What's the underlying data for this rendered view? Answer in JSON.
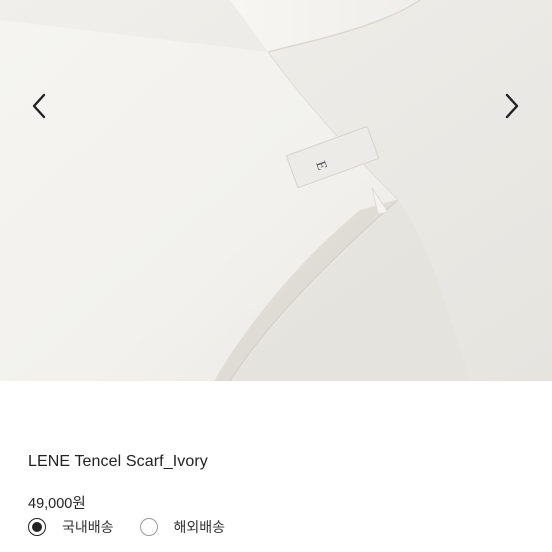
{
  "carousel": {
    "tag_letter": "E",
    "prev_icon": "chevron-left-icon",
    "next_icon": "chevron-right-icon"
  },
  "product": {
    "title": "LENE Tencel Scarf_Ivory",
    "price": "49,000원"
  },
  "shipping": {
    "options": [
      {
        "label": "국내배송",
        "selected": true
      },
      {
        "label": "해외배송",
        "selected": false
      }
    ]
  },
  "colors": {
    "text": "#222222",
    "fabric": "#f4f3ef",
    "background": "#e9e7e2"
  }
}
